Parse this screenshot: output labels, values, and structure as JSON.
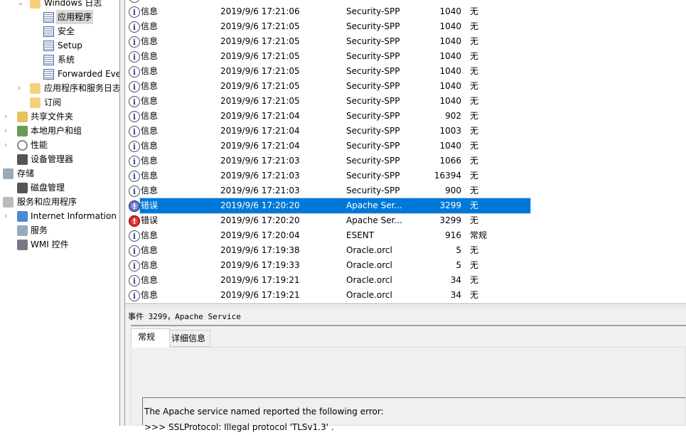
{
  "tree": [
    {
      "label": "Windows 日志",
      "icon": "folder-windows-logs-icon",
      "chev": "⌄"
    },
    {
      "label": "应用程序",
      "icon": "log-warning-icon",
      "selected": true
    },
    {
      "label": "安全",
      "icon": "log-warning-icon"
    },
    {
      "label": "Setup",
      "icon": "log-icon"
    },
    {
      "label": "系统",
      "icon": "log-warning-icon"
    },
    {
      "label": "Forwarded Eve",
      "icon": "log-icon"
    },
    {
      "label": "应用程序和服务日志",
      "icon": "folder-icon",
      "chev": "›"
    },
    {
      "label": "订阅",
      "icon": "subscription-icon"
    },
    {
      "label": "共享文件夹",
      "icon": "shared-folder-icon",
      "chev": "›"
    },
    {
      "label": "本地用户和组",
      "icon": "users-icon",
      "chev": "›"
    },
    {
      "label": "性能",
      "icon": "performance-icon",
      "chev": "›"
    },
    {
      "label": "设备管理器",
      "icon": "device-manager-icon"
    },
    {
      "label": "存储",
      "icon": "storage-icon"
    },
    {
      "label": "磁盘管理",
      "icon": "disk-icon"
    },
    {
      "label": "服务和应用程序",
      "icon": "services-apps-icon"
    },
    {
      "label": "Internet Information S",
      "icon": "iis-icon",
      "chev": "›"
    },
    {
      "label": "服务",
      "icon": "gear-icon"
    },
    {
      "label": "WMI 控件",
      "icon": "wmi-icon"
    }
  ],
  "events": [
    {
      "level": "信息",
      "type": "info",
      "date": "2019/9/6 17:21:06",
      "source": "Security-SPP",
      "id": "1040",
      "category": "无"
    },
    {
      "level": "信息",
      "type": "info",
      "date": "2019/9/6 17:21:05",
      "source": "Security-SPP",
      "id": "1040",
      "category": "无"
    },
    {
      "level": "信息",
      "type": "info",
      "date": "2019/9/6 17:21:05",
      "source": "Security-SPP",
      "id": "1040",
      "category": "无"
    },
    {
      "level": "信息",
      "type": "info",
      "date": "2019/9/6 17:21:05",
      "source": "Security-SPP",
      "id": "1040",
      "category": "无"
    },
    {
      "level": "信息",
      "type": "info",
      "date": "2019/9/6 17:21:05",
      "source": "Security-SPP",
      "id": "1040",
      "category": "无"
    },
    {
      "level": "信息",
      "type": "info",
      "date": "2019/9/6 17:21:05",
      "source": "Security-SPP",
      "id": "1040",
      "category": "无"
    },
    {
      "level": "信息",
      "type": "info",
      "date": "2019/9/6 17:21:05",
      "source": "Security-SPP",
      "id": "1040",
      "category": "无"
    },
    {
      "level": "信息",
      "type": "info",
      "date": "2019/9/6 17:21:04",
      "source": "Security-SPP",
      "id": "902",
      "category": "无"
    },
    {
      "level": "信息",
      "type": "info",
      "date": "2019/9/6 17:21:04",
      "source": "Security-SPP",
      "id": "1003",
      "category": "无"
    },
    {
      "level": "信息",
      "type": "info",
      "date": "2019/9/6 17:21:04",
      "source": "Security-SPP",
      "id": "1040",
      "category": "无"
    },
    {
      "level": "信息",
      "type": "info",
      "date": "2019/9/6 17:21:03",
      "source": "Security-SPP",
      "id": "1066",
      "category": "无"
    },
    {
      "level": "信息",
      "type": "info",
      "date": "2019/9/6 17:21:03",
      "source": "Security-SPP",
      "id": "16394",
      "category": "无"
    },
    {
      "level": "信息",
      "type": "info",
      "date": "2019/9/6 17:21:03",
      "source": "Security-SPP",
      "id": "900",
      "category": "无"
    },
    {
      "level": "错误",
      "type": "err",
      "date": "2019/9/6 17:20:20",
      "source": "Apache Ser...",
      "id": "3299",
      "category": "无",
      "selected": true
    },
    {
      "level": "错误",
      "type": "err",
      "date": "2019/9/6 17:20:20",
      "source": "Apache Ser...",
      "id": "3299",
      "category": "无"
    },
    {
      "level": "信息",
      "type": "info",
      "date": "2019/9/6 17:20:04",
      "source": "ESENT",
      "id": "916",
      "category": "常规"
    },
    {
      "level": "信息",
      "type": "info",
      "date": "2019/9/6 17:19:38",
      "source": "Oracle.orcl",
      "id": "5",
      "category": "无"
    },
    {
      "level": "信息",
      "type": "info",
      "date": "2019/9/6 17:19:33",
      "source": "Oracle.orcl",
      "id": "5",
      "category": "无"
    },
    {
      "level": "信息",
      "type": "info",
      "date": "2019/9/6 17:19:21",
      "source": "Oracle.orcl",
      "id": "34",
      "category": "无"
    },
    {
      "level": "信息",
      "type": "info",
      "date": "2019/9/6 17:19:21",
      "source": "Oracle.orcl",
      "id": "34",
      "category": "无"
    }
  ],
  "detail": {
    "title": "事件 3299，Apache Service",
    "tabs": [
      "常规",
      "详细信息"
    ],
    "message_line1": "The Apache service named  reported the following error:",
    "message_line2": ">>> SSLProtocol: Illegal protocol 'TLSv1.3'     ."
  },
  "colors": {
    "selection": "#0078d7",
    "error": "#d00000"
  }
}
